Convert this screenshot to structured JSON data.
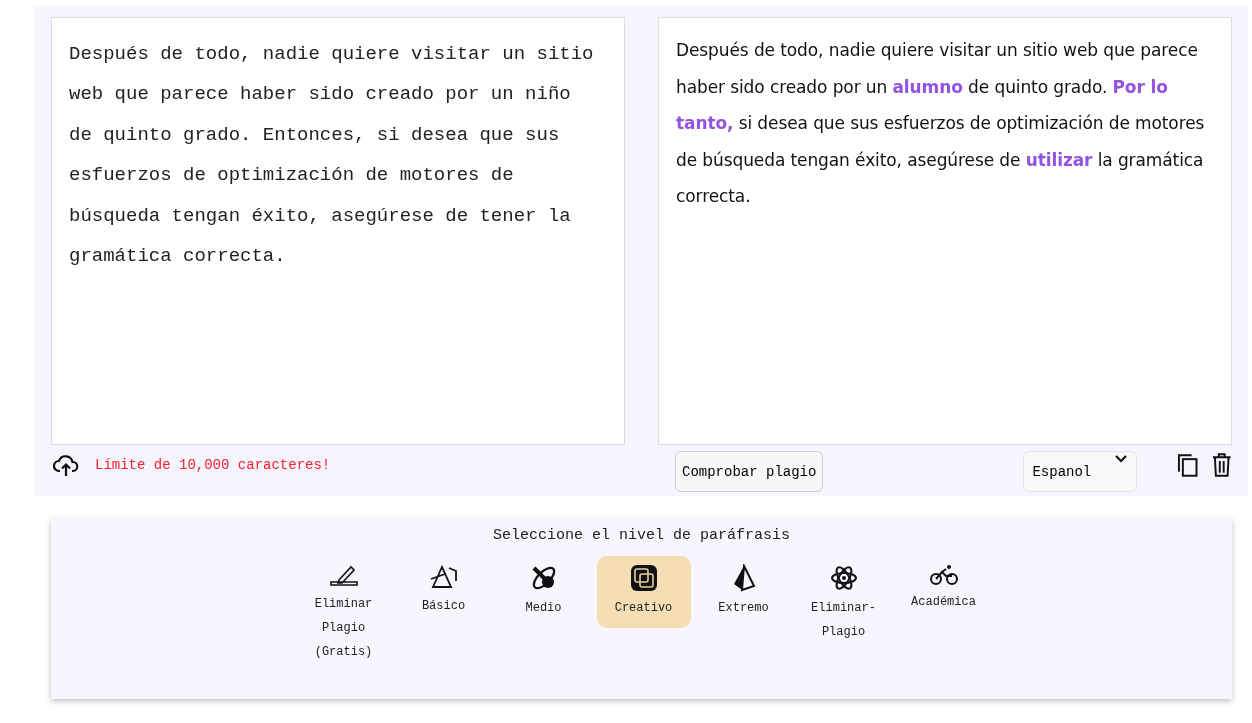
{
  "input_text": "Después de todo, nadie quiere visitar un sitio web que parece haber sido creado por un niño de quinto grado. Entonces, si desea que sus esfuerzos de optimización de motores de búsqueda tengan éxito, asegúrese de tener la gramática correcta.",
  "output_text": "Después de todo, nadie quiere visitar un sitio web que parece haber sido creado por un **alumno** de quinto grado. **Por lo tanto,** si desea que sus esfuerzos de optimización de motores de búsqueda tengan éxito, asegúrese de **utilizar** la gramática correcta.",
  "char_limit": "Límite de 10,000 caracteres!",
  "check_button": "Comprobar plagio",
  "language": "Espanol",
  "level_title": "Seleccione el nivel de paráfrasis",
  "levels": [
    {
      "kind": "highlighter",
      "label": "Eliminar Plagio (Gratis)",
      "selected": false
    },
    {
      "kind": "prism",
      "label": "Básico",
      "selected": false
    },
    {
      "kind": "planet",
      "label": "Medio",
      "selected": false
    },
    {
      "kind": "squares",
      "label": "Creativo",
      "selected": true
    },
    {
      "kind": "pyramid",
      "label": "Extremo",
      "selected": false
    },
    {
      "kind": "atom",
      "label": "Eliminar-Plagio",
      "selected": false
    },
    {
      "kind": "bike",
      "label": "Académica",
      "selected": false
    }
  ]
}
